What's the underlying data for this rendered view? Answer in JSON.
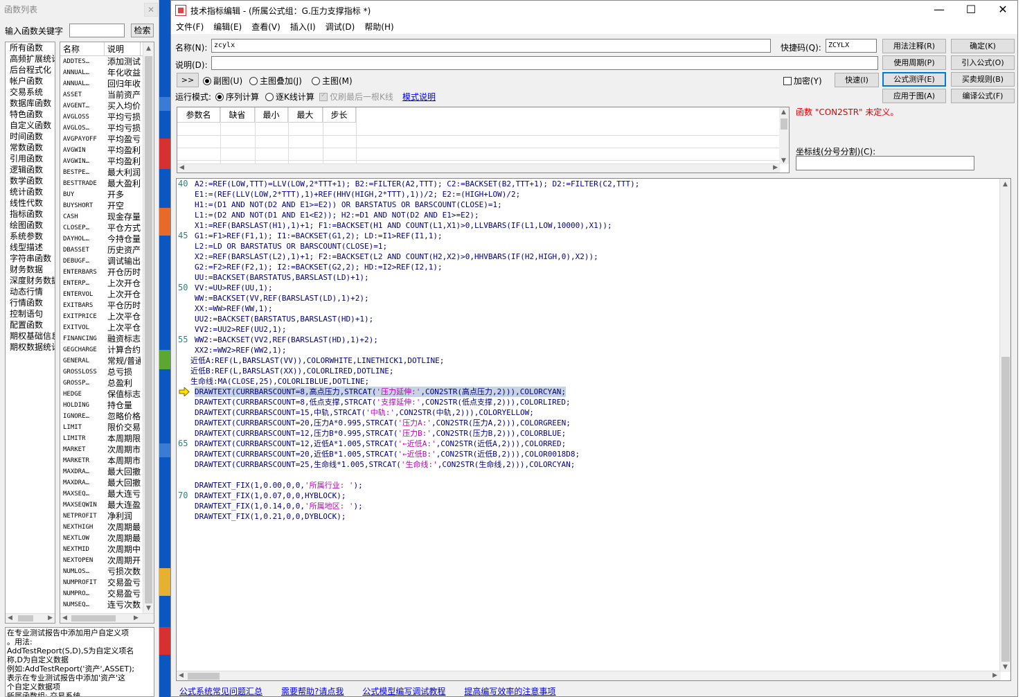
{
  "left_panel": {
    "title": "函数列表",
    "close": "✕",
    "keyword_label": "输入函数关键字",
    "keyword_value": "",
    "search_button": "检索",
    "categories": [
      "所有函数",
      "高频扩展统计",
      "后台程式化",
      "帐户函数",
      "交易系统",
      "数据库函数",
      "特色函数",
      "自定义函数",
      "时间函数",
      "常数函数",
      "引用函数",
      "逻辑函数",
      "数学函数",
      "统计函数",
      "线性代数",
      "指标函数",
      "绘图函数",
      "系统参数",
      "线型描述",
      "字符串函数",
      "财务数据",
      "深度财务数据",
      "动态行情",
      "行情函数",
      "控制语句",
      "配置函数",
      "期权基础信息",
      "期权数据统计"
    ],
    "func_headers": [
      "名称",
      "说明"
    ],
    "functions": [
      [
        "ADDTES…",
        "添加测试"
      ],
      [
        "ANNUAL…",
        "年化收益"
      ],
      [
        "ANNUAL…",
        "回归年收"
      ],
      [
        "ASSET",
        "当前资产"
      ],
      [
        "AVGENT…",
        "买入均价"
      ],
      [
        "AVGLOSS",
        "平均亏损"
      ],
      [
        "AVGLOS…",
        "平均亏损"
      ],
      [
        "AVGPAYOFF",
        "平均盈亏"
      ],
      [
        "AVGWIN",
        "平均盈利"
      ],
      [
        "AVGWIN…",
        "平均盈利"
      ],
      [
        "BESTPE…",
        "最大利润"
      ],
      [
        "BESTTRADE",
        "最大盈利"
      ],
      [
        "BUY",
        "开多"
      ],
      [
        "BUYSHORT",
        "开空"
      ],
      [
        "CASH",
        "现金存量"
      ],
      [
        "CLOSEP…",
        "平仓方式"
      ],
      [
        "DAYHOL…",
        "今持仓量"
      ],
      [
        "DBASSET",
        "历史资产"
      ],
      [
        "DEBUGF…",
        "调试输出"
      ],
      [
        "ENTERBARS",
        "开仓历时"
      ],
      [
        "ENTERP…",
        "上次开仓"
      ],
      [
        "ENTERVOL",
        "上次开仓"
      ],
      [
        "EXITBARS",
        "平仓历时"
      ],
      [
        "EXITPRICE",
        "上次平仓"
      ],
      [
        "EXITVOL",
        "上次平仓"
      ],
      [
        "FINANCING",
        "融资标志"
      ],
      [
        "GEGCHARGE",
        "计算合约"
      ],
      [
        "GENERAL",
        "常规/普通"
      ],
      [
        "GROSSLOSS",
        "总亏损"
      ],
      [
        "GROSSP…",
        "总盈利"
      ],
      [
        "HEDGE",
        "保值标志"
      ],
      [
        "HOLDING",
        "持仓量"
      ],
      [
        "IGNORE…",
        "忽略价格"
      ],
      [
        "LIMIT",
        "限价交易"
      ],
      [
        "LIMITR",
        "本周期限"
      ],
      [
        "MARKET",
        "次周期市"
      ],
      [
        "MARKETR",
        "本周期市"
      ],
      [
        "MAXDRA…",
        "最大回撤"
      ],
      [
        "MAXDRA…",
        "最大回撤"
      ],
      [
        "MAXSEQ…",
        "最大连亏"
      ],
      [
        "MAXSEQWIN",
        "最大连盈"
      ],
      [
        "NETPROFIT",
        "净利润"
      ],
      [
        "NEXTHIGH",
        "次周期最"
      ],
      [
        "NEXTLOW",
        "次周期最"
      ],
      [
        "NEXTMID",
        "次周期中"
      ],
      [
        "NEXTOPEN",
        "次周期开"
      ],
      [
        "NUMLOS…",
        "亏损次数"
      ],
      [
        "NUMPROFIT",
        "交易盈亏"
      ],
      [
        "NUMPRO…",
        "交易盈亏"
      ],
      [
        "NUMSEQ…",
        "连亏次数"
      ]
    ],
    "description": "在专业测试报告中添加用户自定义项\n。用法:\nAddTestReport(S,D),S为自定义项名\n称,D为自定义数据\n例如:AddTestReport('资产',ASSET);\n表示在专业测试报告中添加'资产'这\n个自定义数据项\n所属函数组: 交易系统"
  },
  "window": {
    "title": "技术指标编辑 - (所属公式组：G.压力支撑指标 *)",
    "controls": [
      "—",
      "☐",
      "✕"
    ],
    "menu": [
      "文件(F)",
      "编辑(E)",
      "查看(V)",
      "插入(I)",
      "调试(D)",
      "帮助(H)"
    ]
  },
  "form": {
    "name_label": "名称(N):",
    "name_value": "zcylx",
    "shortcut_label": "快捷码(Q):",
    "shortcut_value": "ZCYLX",
    "desc_label": "说明(D):",
    "desc_value": "",
    "expand_button": ">>",
    "chart_options": [
      "副图(U)",
      "主图叠加(J)",
      "主图(M)"
    ],
    "encrypt_label": "加密(Y)",
    "fast_button": "快速(I)",
    "run_mode_label": "运行模式:",
    "run_options": [
      "序列计算",
      "逐K线计算"
    ],
    "refresh_label": "仅刷最后一根K线",
    "mode_link": "模式说明",
    "right_buttons": [
      "用法注释(R)",
      "确定(K)",
      "使用周期(P)",
      "引入公式(O)",
      "公式测评(E)",
      "买卖规则(B)",
      "应用于图(A)",
      "编译公式(F)"
    ],
    "param_headers": [
      "参数名",
      "缺省",
      "最小",
      "最大",
      "步长"
    ],
    "error_message": "函数 \"CON2STR\" 未定义。",
    "axis_label": "坐标线(分号分割)(C):",
    "axis_value": ""
  },
  "editor": {
    "line_numbers": [
      "40",
      "45",
      "50",
      "55",
      "65",
      "70"
    ],
    "highlighted_line": "DRAWTEXT(CURRBARSCOUNT=8,高点压力,STRCAT('压力延伸:',CON2STR(高点压力,2))),COLORCYAN;",
    "lines": [
      "A2:=REF(LOW,TTT)=LLV(LOW,2*TTT+1); B2:=FILTER(A2,TTT); C2:=BACKSET(B2,TTT+1); D2:=FILTER(C2,TTT);",
      "E1:=(REF(LLV(LOW,2*TTT),1)+REF(HHV(HIGH,2*TTT),1))/2; E2:=(HIGH+LOW)/2;",
      "H1:=(D1 AND NOT(D2 AND E1>=E2)) OR BARSTATUS OR BARSCOUNT(CLOSE)=1;",
      "L1:=(D2 AND NOT(D1 AND E1<E2)); H2:=D1 AND NOT(D2 AND E1>=E2);",
      "X1:=REF(BARSLAST(H1),1)+1; F1:=BACKSET(H1 AND COUNT(L1,X1)>0,LLVBARS(IF(L1,LOW,10000),X1));",
      "G1:=F1>REF(F1,1); I1:=BACKSET(G1,2); LD:=I1>REF(I1,1);",
      "L2:=LD OR BARSTATUS OR BARSCOUNT(CLOSE)=1;",
      "X2:=REF(BARSLAST(L2),1)+1; F2:=BACKSET(L2 AND COUNT(H2,X2)>0,HHVBARS(IF(H2,HIGH,0),X2));",
      "G2:=F2>REF(F2,1); I2:=BACKSET(G2,2); HD:=I2>REF(I2,1);",
      "UU:=BACKSET(BARSTATUS,BARSLAST(LD)+1);",
      "VV:=UU>REF(UU,1);",
      "WW:=BACKSET(VV,REF(BARSLAST(LD),1)+2);",
      "XX:=WW>REF(WW,1);",
      "UU2:=BACKSET(BARSTATUS,BARSLAST(HD)+1);",
      "VV2:=UU2>REF(UU2,1);",
      "WW2:=BACKSET(VV2,REF(BARSLAST(HD),1)+2);",
      "XX2:=WW2>REF(WW2,1);",
      "近低A:REF(L,BARSLAST(VV)),COLORWHITE,LINETHICK1,DOTLINE;",
      "近低B:REF(L,BARSLAST(XX)),COLORLIRED,DOTLINE;",
      "生命线:MA(CLOSE,25),COLORLIBLUE,DOTLINE;",
      "DRAWTEXT(CURRBARSCOUNT=8,高点压力,STRCAT('压力延伸:',CON2STR(高点压力,2))),COLORCYAN;",
      "DRAWTEXT(CURRBARSCOUNT=8,低点支撑,STRCAT('支撑延伸:',CON2STR(低点支撑,2))),COLORLIRED;",
      "DRAWTEXT(CURRBARSCOUNT=15,中轨,STRCAT('中轨:',CON2STR(中轨,2))),COLORYELLOW;",
      "DRAWTEXT(CURRBARSCOUNT=20,压力A*0.995,STRCAT('压力A:',CON2STR(压力A,2))),COLORGREEN;",
      "DRAWTEXT(CURRBARSCOUNT=12,压力B*0.995,STRCAT('压力B:',CON2STR(压力B,2))),COLORBLUE;",
      "DRAWTEXT(CURRBARSCOUNT=12,近低A*1.005,STRCAT('←近低A:',CON2STR(近低A,2))),COLORRED;",
      "DRAWTEXT(CURRBARSCOUNT=20,近低B*1.005,STRCAT('←近低B:',CON2STR(近低B,2))),COLOR0018D8;",
      "DRAWTEXT(CURRBARSCOUNT=25,生命线*1.005,STRCAT('生命线:',CON2STR(生命线,2))),COLORCYAN;",
      "",
      "DRAWTEXT_FIX(1,0.00,0,0,'所属行业: ');",
      "DRAWTEXT_FIX(1,0.07,0,0,HYBLOCK);",
      "DRAWTEXT_FIX(1,0.14,0,0,'所属地区: ');",
      "DRAWTEXT_FIX(1,0.21,0,0,DYBLOCK);"
    ]
  },
  "footer_links": [
    "公式系统常见问题汇总",
    "需要帮助?请点我",
    "公式模型编写调试教程",
    "提高编写效率的注意事项"
  ],
  "colors": {
    "accent": "#0078d7",
    "error": "#e00000",
    "keyword": "#00007f",
    "highlight": "#c8d4e4",
    "taskbar": "#0a57c2"
  }
}
